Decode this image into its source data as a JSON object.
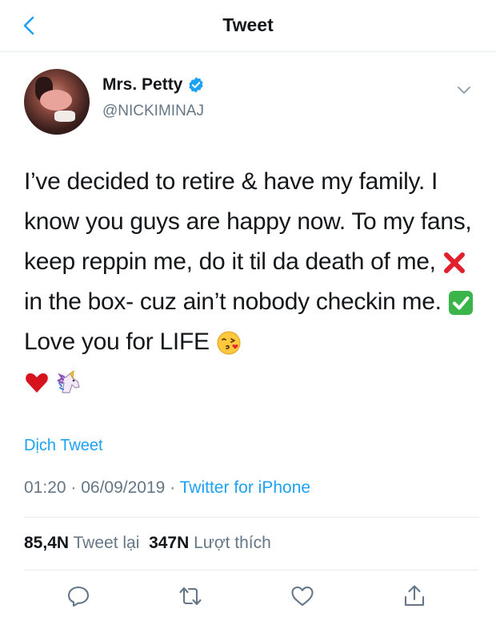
{
  "header": {
    "title": "Tweet",
    "back_icon": "chevron-left-icon"
  },
  "author": {
    "display_name": "Mrs. Petty",
    "handle": "@NICKIMINAJ",
    "verified": true,
    "verified_color": "#1da1f2"
  },
  "tweet": {
    "text_part1": "I’ve decided to retire & have my family. I know you guys are happy now. To my fans, keep reppin me, do it til da death of me, ",
    "text_part2": " in the box- cuz ain’t nobody checkin me. ",
    "text_part3": " Love you for LIFE ",
    "emojis": [
      "cross-mark-emoji",
      "check-mark-button-emoji",
      "face-blowing-kiss-emoji",
      "red-heart-emoji",
      "unicorn-emoji"
    ]
  },
  "translate_label": "Dịch Tweet",
  "meta": {
    "time": "01:20",
    "separator1": " · ",
    "date": "06/09/2019",
    "separator2": " · ",
    "source": "Twitter for iPhone"
  },
  "stats": {
    "retweets_count": "85,4N",
    "retweets_label": "Tweet lại",
    "likes_count": "347N",
    "likes_label": "Lượt thích"
  },
  "actions": [
    "reply-icon",
    "retweet-icon",
    "like-icon",
    "share-icon"
  ],
  "colors": {
    "accent": "#1da1f2",
    "secondary_text": "#657786",
    "border": "#e6ecf0"
  }
}
